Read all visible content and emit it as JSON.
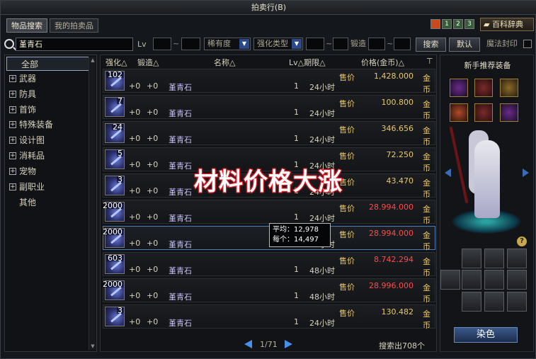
{
  "window": {
    "title": "拍卖行(B)"
  },
  "tabs": [
    {
      "label": "物品搜索"
    },
    {
      "label": "我的拍卖品"
    }
  ],
  "top_icons": [
    "1",
    "2",
    "3"
  ],
  "encyclopedia_label": "百科辞典",
  "search": {
    "query": "堇青石",
    "lv_label": "Lv",
    "rarity_label": "稀有度",
    "enhance_type_label": "强化类型",
    "forge_label": "锻造",
    "search_button": "搜索",
    "default_button": "默认",
    "seal_label": "魔法封印"
  },
  "categories": [
    {
      "label": "全部",
      "expandable": false,
      "selected": true
    },
    {
      "label": "武器",
      "expandable": true
    },
    {
      "label": "防具",
      "expandable": true
    },
    {
      "label": "首饰",
      "expandable": true
    },
    {
      "label": "特殊装备",
      "expandable": true
    },
    {
      "label": "设计图",
      "expandable": true
    },
    {
      "label": "消耗品",
      "expandable": true
    },
    {
      "label": "宠物",
      "expandable": true
    },
    {
      "label": "副职业",
      "expandable": true
    },
    {
      "label": "其他",
      "expandable": false
    }
  ],
  "columns": {
    "enhance": "强化△",
    "forge": "锻造△",
    "name": "名称△",
    "lv_period": "Lv△期限△",
    "price": "价格(金币)△"
  },
  "listings": [
    {
      "qty": "102",
      "enhance": "+0",
      "forge": "+0",
      "name": "堇青石",
      "lv": "1",
      "period": "24小时",
      "unit": "售价",
      "price": "1,428.000",
      "currency": "金币",
      "price_color": "#e8c86a"
    },
    {
      "qty": "7",
      "enhance": "+0",
      "forge": "+0",
      "name": "堇青石",
      "lv": "1",
      "period": "24小时",
      "unit": "售价",
      "price": "100.800",
      "currency": "金币",
      "price_color": "#e8c86a"
    },
    {
      "qty": "24",
      "enhance": "+0",
      "forge": "+0",
      "name": "堇青石",
      "lv": "1",
      "period": "24小时",
      "unit": "售价",
      "price": "346.656",
      "currency": "金币",
      "price_color": "#e8c86a"
    },
    {
      "qty": "5",
      "enhance": "+0",
      "forge": "+0",
      "name": "堇青石",
      "lv": "1",
      "period": "24小时",
      "unit": "售价",
      "price": "72.250",
      "currency": "金币",
      "price_color": "#e8c86a"
    },
    {
      "qty": "3",
      "enhance": "+0",
      "forge": "+0",
      "name": "堇青石",
      "lv": "1",
      "period": "24小时",
      "unit": "售价",
      "price": "43.470",
      "currency": "金币",
      "price_color": "#e8c86a"
    },
    {
      "qty": "2000",
      "enhance": "+0",
      "forge": "+0",
      "name": "堇青石",
      "lv": "1",
      "period": "24小时",
      "unit": "售价",
      "price": "28.994.000",
      "currency": "金币",
      "price_color": "#ff4a4a"
    },
    {
      "qty": "2000",
      "enhance": "+0",
      "forge": "+0",
      "name": "堇青石",
      "lv": "1",
      "period": "24小时",
      "unit": "售价",
      "price": "28.994.000",
      "currency": "金币",
      "price_color": "#ff4a4a"
    },
    {
      "qty": "603",
      "enhance": "+0",
      "forge": "+0",
      "name": "堇青石",
      "lv": "1",
      "period": "48小时",
      "unit": "售价",
      "price": "8.742.294",
      "currency": "金币",
      "price_color": "#ff4a4a"
    },
    {
      "qty": "2000",
      "enhance": "+0",
      "forge": "+0",
      "name": "堇青石",
      "lv": "1",
      "period": "48小时",
      "unit": "售价",
      "price": "28.996.000",
      "currency": "金币",
      "price_color": "#ff4a4a"
    },
    {
      "qty": "3",
      "enhance": "+0",
      "forge": "+0",
      "name": "堇青石",
      "lv": "1",
      "period": "24小时",
      "unit": "售价",
      "price": "130.482",
      "currency": "金币",
      "price_color": "#e8c86a"
    }
  ],
  "overlay_text": "材料价格大涨",
  "tooltip": {
    "line1": "平均：12,978",
    "line2": "每个：14,497"
  },
  "pager": {
    "text": "1/71"
  },
  "result_count": "搜索出708个",
  "recommend": {
    "title": "新手推荐装备",
    "dye_button": "染色"
  }
}
